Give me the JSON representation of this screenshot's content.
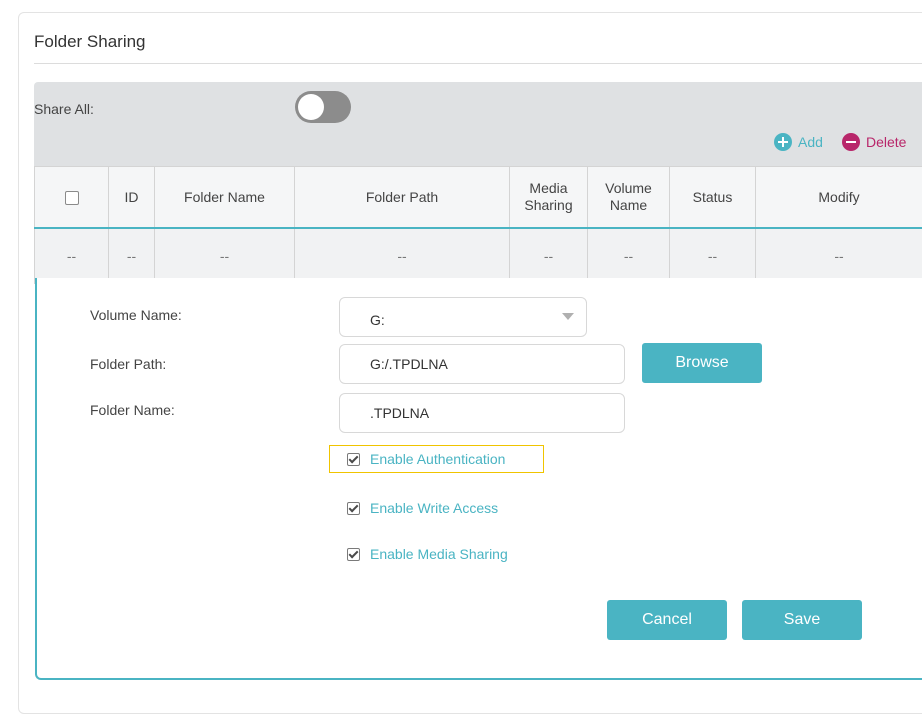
{
  "page": {
    "title": "Folder Sharing"
  },
  "share_all": {
    "label": "Share All:",
    "enabled": false
  },
  "actions": {
    "add_label": "Add",
    "delete_label": "Delete"
  },
  "table": {
    "columns": [
      "",
      "ID",
      "Folder Name",
      "Folder Path",
      "Media Sharing",
      "Volume Name",
      "Status",
      "Modify"
    ],
    "rows": [
      [
        "--",
        "--",
        "--",
        "--",
        "--",
        "--",
        "--",
        "--"
      ]
    ]
  },
  "form": {
    "volume_name": {
      "label": "Volume Name:",
      "value": "G:"
    },
    "folder_path": {
      "label": "Folder Path:",
      "value": "G:/.TPDLNA"
    },
    "folder_name": {
      "label": "Folder Name:",
      "value": ".TPDLNA"
    },
    "browse_label": "Browse",
    "enable_authentication": {
      "label": "Enable Authentication",
      "checked": true
    },
    "enable_write_access": {
      "label": "Enable Write Access",
      "checked": true
    },
    "enable_media_sharing": {
      "label": "Enable Media Sharing",
      "checked": true
    },
    "cancel_label": "Cancel",
    "save_label": "Save"
  },
  "colors": {
    "accent": "#4ab4c3",
    "delete": "#b8266a",
    "highlight": "#f0c400"
  }
}
